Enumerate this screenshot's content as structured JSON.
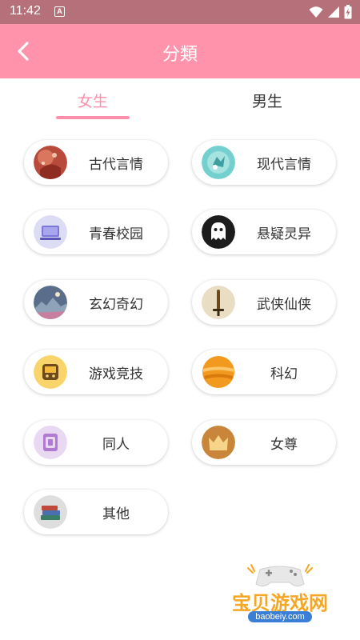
{
  "status_bar": {
    "time": "11:42",
    "notification_letter": "A"
  },
  "app_bar": {
    "title": "分類"
  },
  "tabs": [
    {
      "label": "女生",
      "selected": true
    },
    {
      "label": "男生",
      "selected": false
    }
  ],
  "categories": [
    {
      "label": "古代言情",
      "icon": "ancient-romance-icon"
    },
    {
      "label": "现代言情",
      "icon": "modern-romance-icon"
    },
    {
      "label": "青春校园",
      "icon": "youth-campus-icon"
    },
    {
      "label": "悬疑灵异",
      "icon": "ghost-icon"
    },
    {
      "label": "玄幻奇幻",
      "icon": "fantasy-landscape-icon"
    },
    {
      "label": "武侠仙侠",
      "icon": "sword-icon"
    },
    {
      "label": "游戏竞技",
      "icon": "game-console-icon"
    },
    {
      "label": "科幻",
      "icon": "planet-icon"
    },
    {
      "label": "同人",
      "icon": "fan-fiction-icon"
    },
    {
      "label": "女尊",
      "icon": "crown-icon"
    },
    {
      "label": "其他",
      "icon": "books-icon"
    }
  ],
  "watermark": {
    "title": "宝贝游戏网",
    "url": "baobeiy.com"
  },
  "colors": {
    "accent": "#ff93ac",
    "status_bar": "#b5707a",
    "text": "#333333"
  }
}
